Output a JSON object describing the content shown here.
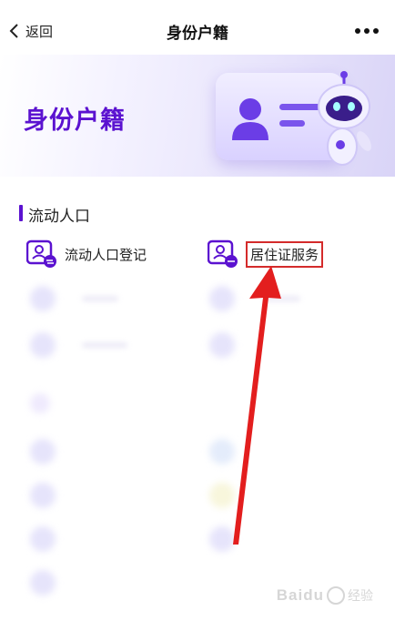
{
  "header": {
    "back_label": "返回",
    "title": "身份户籍"
  },
  "banner": {
    "title": "身份户籍"
  },
  "section": {
    "title": "流动人口"
  },
  "services": [
    {
      "label": "流动人口登记"
    },
    {
      "label": "居住证服务"
    }
  ],
  "watermark": {
    "text": "Baidu",
    "suffix": "经验"
  },
  "colors": {
    "accent": "#5b12d0",
    "highlight": "#d42b2b",
    "arrow": "#e31e1e"
  }
}
